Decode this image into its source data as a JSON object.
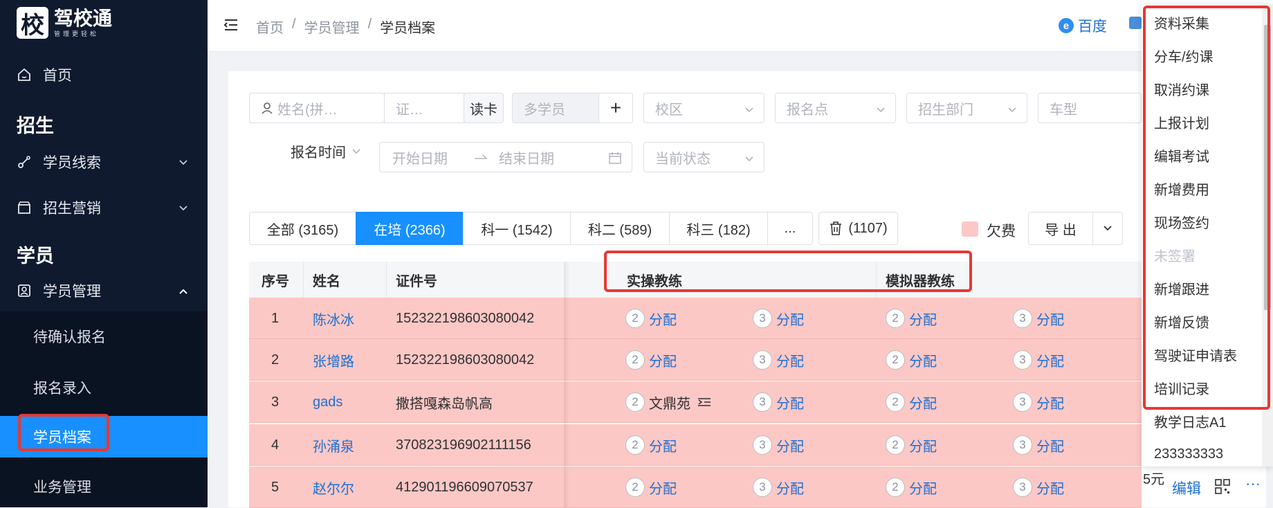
{
  "brand": {
    "logo_char": "校",
    "name": "驾校通",
    "slogan": "管理更轻松"
  },
  "sidebar": {
    "home": "首页",
    "group_recruit": "招生",
    "leads": "学员线索",
    "marketing": "招生营销",
    "group_student": "学员",
    "student_mgmt": "学员管理",
    "subitems": [
      "待确认报名",
      "报名录入",
      "学员档案",
      "业务管理"
    ]
  },
  "header": {
    "breadcrumb": [
      "首页",
      "/",
      "学员管理",
      "/",
      "学员档案"
    ],
    "link_baidu": "百度"
  },
  "filters": {
    "name_placeholder": "姓名(拼…",
    "id_placeholder": "证…",
    "read_card": "读卡",
    "multi_student": "多学员",
    "add": "+",
    "campus": "校区",
    "signup_point": "报名点",
    "dept": "招生部门",
    "car_type": "车型",
    "signup_time": "报名时间",
    "start_date": "开始日期",
    "end_date": "结束日期",
    "status": "当前状态"
  },
  "tabs": [
    "全部 (3165)",
    "在培 (2366)",
    "科一 (1542)",
    "科二 (589)",
    "科三 (182)",
    "...",
    "(1107)"
  ],
  "arrears_label": "欠费",
  "export_label": "导 出",
  "table": {
    "headers": [
      "序号",
      "姓名",
      "证件号",
      "实操教练",
      "模拟器教练"
    ],
    "rows": [
      {
        "no": "1",
        "name": "陈冰冰",
        "id": "152322198603080042",
        "c1": "分配",
        "c2": "分配",
        "c3": "分配",
        "c4": "分配"
      },
      {
        "no": "2",
        "name": "张增路",
        "id": "152322198603080042",
        "c1": "分配",
        "c2": "分配",
        "c3": "分配",
        "c4": "分配"
      },
      {
        "no": "3",
        "name": "gads",
        "id": "撒搭嘎森岛帆高",
        "c1": "文鼎苑",
        "c2": "分配",
        "c3": "分配",
        "c4": "分配"
      },
      {
        "no": "4",
        "name": "孙涌泉",
        "id": "370823196902111156",
        "c1": "分配",
        "c2": "分配",
        "c3": "分配",
        "c4": "分配"
      },
      {
        "no": "5",
        "name": "赵尔尔",
        "id": "412901196609070537",
        "c1": "分配",
        "c2": "分配",
        "c3": "分配",
        "c4": "分配"
      }
    ],
    "badge_a": "2",
    "badge_b": "3",
    "row5_extra": "5元",
    "edit_label": "编辑",
    "more_label": "···"
  },
  "dropdown": [
    "资料采集",
    "分车/约课",
    "取消约课",
    "上报计划",
    "编辑考试",
    "新增费用",
    "现场签约",
    "未签署",
    "新增跟进",
    "新增反馈",
    "驾驶证申请表",
    "培训记录",
    "教学日志A1",
    "233333333"
  ],
  "colors": {
    "sidebar_bg": "#0f1a2e",
    "active": "#1890ff",
    "row_warn": "#fcc8c5",
    "highlight": "#e53935",
    "link": "#1f6fd1"
  }
}
